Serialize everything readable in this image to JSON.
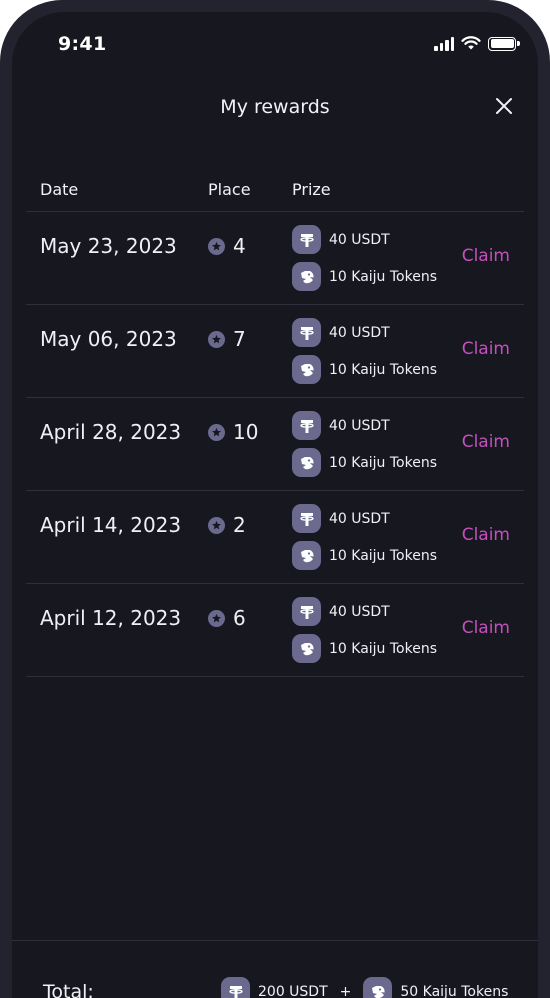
{
  "status_bar": {
    "time": "9:41"
  },
  "header": {
    "title": "My rewards"
  },
  "table": {
    "columns": {
      "date": "Date",
      "place": "Place",
      "prize": "Prize"
    },
    "claim_label": "Claim",
    "rows": [
      {
        "date": "May 23, 2023",
        "place": "4",
        "usdt": "40 USDT",
        "kaiju": "10 Kaiju Tokens"
      },
      {
        "date": "May 06, 2023",
        "place": "7",
        "usdt": "40 USDT",
        "kaiju": "10 Kaiju Tokens"
      },
      {
        "date": "April 28, 2023",
        "place": "10",
        "usdt": "40 USDT",
        "kaiju": "10 Kaiju Tokens"
      },
      {
        "date": "April 14, 2023",
        "place": "2",
        "usdt": "40 USDT",
        "kaiju": "10 Kaiju Tokens"
      },
      {
        "date": "April 12, 2023",
        "place": "6",
        "usdt": "40 USDT",
        "kaiju": "10 Kaiju Tokens"
      }
    ]
  },
  "footer": {
    "total_label": "Total:",
    "total_usdt": "200 USDT",
    "plus": "+",
    "total_kaiju": "50 Kaiju Tokens"
  },
  "icons": {
    "usdt": "tether-icon",
    "kaiju": "kaiju-token-icon",
    "place": "star-icon",
    "close": "close-icon"
  },
  "colors": {
    "background": "#171720",
    "accent_claim": "#c54fbd",
    "token_badge": "#6b6a8e",
    "divider": "#2f2f3c"
  }
}
